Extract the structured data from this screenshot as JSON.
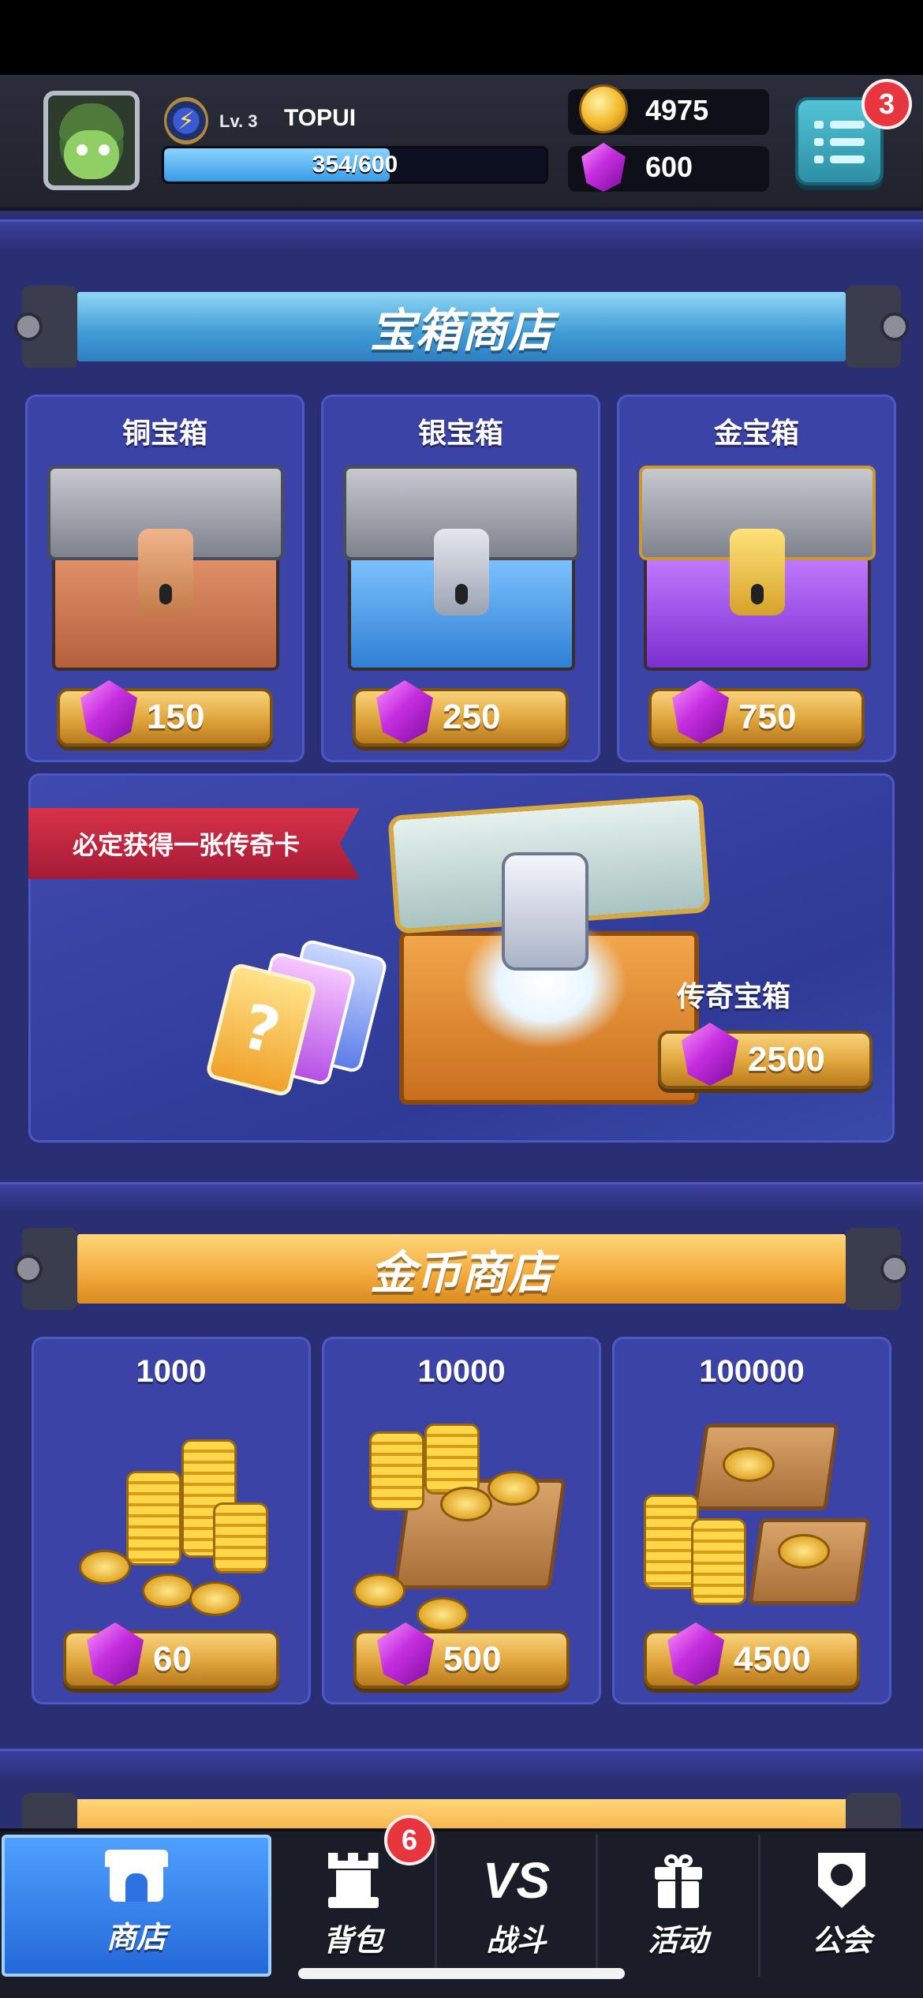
{
  "header": {
    "level": "Lv. 3",
    "username": "TOPUI",
    "xp_text": "354/600",
    "xp_fraction": 0.59,
    "coins": "4975",
    "gems": "600",
    "menu_badge": "3"
  },
  "chest_shop": {
    "title": "宝箱商店",
    "chests": [
      {
        "name": "铜宝箱",
        "price": "150"
      },
      {
        "name": "银宝箱",
        "price": "250"
      },
      {
        "name": "金宝箱",
        "price": "750"
      }
    ],
    "legendary": {
      "ribbon": "必定获得一张传奇卡",
      "name": "传奇宝箱",
      "price": "2500",
      "card_symbol": "?"
    }
  },
  "coin_shop": {
    "title": "金币商店",
    "packs": [
      {
        "amount": "1000",
        "price": "60"
      },
      {
        "amount": "10000",
        "price": "500"
      },
      {
        "amount": "100000",
        "price": "4500"
      }
    ]
  },
  "tabs": [
    {
      "label": "商店",
      "icon": "shop-icon",
      "active": true
    },
    {
      "label": "背包",
      "icon": "backpack-tower-icon",
      "badge": "6"
    },
    {
      "label": "战斗",
      "icon": "vs-icon",
      "icon_text": "VS"
    },
    {
      "label": "活动",
      "icon": "gift-icon"
    },
    {
      "label": "公会",
      "icon": "guild-shield-icon"
    }
  ],
  "colors": {
    "panel": "#3b43a6",
    "background": "#2a2f73",
    "active_tab": "#2f7ff0",
    "badge": "#e8363f"
  }
}
